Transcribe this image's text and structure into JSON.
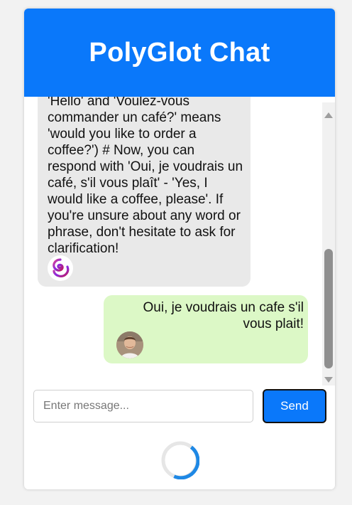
{
  "app": {
    "title": "PolyGlot Chat"
  },
  "messages": [
    {
      "sender": "bot",
      "text": "'Hello' and 'Voulez-vous commander un café?' means 'would you like to order a coffee?') # Now, you can respond with 'Oui, je voudrais un café, s'il vous plaît' - 'Yes, I would like a coffee, please'. If you're unsure about any word or phrase, don't hesitate to ask for clarification!",
      "avatar_icon": "polyglot-swirl-logo-icon"
    },
    {
      "sender": "user",
      "text": "Oui, je voudrais un cafe s'il vous plait!",
      "avatar_icon": "user-photo-avatar"
    }
  ],
  "composer": {
    "placeholder": "Enter message...",
    "value": "",
    "send_label": "Send"
  },
  "status": {
    "loading": true,
    "loading_icon": "spinner-icon"
  },
  "colors": {
    "header": "#0a78fa",
    "bot_bubble": "#e9e9e9",
    "user_bubble": "#dcf8c6",
    "send_button": "#0a78fa",
    "spinner": "#1e88e5"
  }
}
